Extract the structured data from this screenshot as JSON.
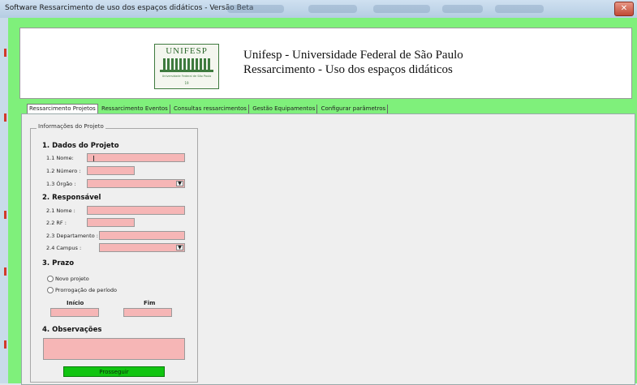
{
  "window": {
    "title": "Software Ressarcimento de uso dos espaços didáticos - Versão Beta",
    "close_label": "✕"
  },
  "header": {
    "logo": {
      "text": "UNIFESP",
      "subtitle": "Universidade Federal de São Paulo",
      "year": "19"
    },
    "line1": "Unifesp - Universidade Federal de São Paulo",
    "line2": "Ressarcimento - Uso dos espaços didáticos"
  },
  "tabs": [
    {
      "label": "Ressarcimento Projetos",
      "active": true
    },
    {
      "label": "Ressarcimento Eventos"
    },
    {
      "label": "Consultas ressarcimentos"
    },
    {
      "label": "Gestão Equipamentos"
    },
    {
      "label": "Configurar parâmetros"
    }
  ],
  "form": {
    "legend": "Informações do Projeto",
    "section1": {
      "title": "1. Dados do Projeto",
      "nome": "1.1 Nome:",
      "numero": "1.2 Número :",
      "orgao": "1.3 Órgão :"
    },
    "section2": {
      "title": "2. Responsável",
      "nome": "2.1 Nome :",
      "rf": "2.2 RF :",
      "departamento": "2.3 Departamento :",
      "campus": "2.4 Campus :"
    },
    "section3": {
      "title": "3. Prazo",
      "opt_novo": "Novo projeto",
      "opt_prorrogacao": "Prorrogação de período",
      "inicio": "Início",
      "fim": "Fim"
    },
    "section4": {
      "title": "4. Observações"
    },
    "submit_label": "Prosseguir",
    "field_color": "#f6b6b6",
    "dropdown_icon": "chevron-down-icon"
  },
  "colors": {
    "background": "#7ff07b",
    "button": "#11c411"
  }
}
